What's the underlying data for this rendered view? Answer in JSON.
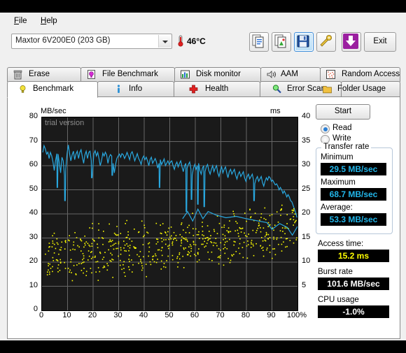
{
  "menu": {
    "file": "File",
    "help": "Help"
  },
  "device": {
    "selected": "Maxtor 6V200E0 (203 GB)",
    "temperature": "46°C",
    "thermometer_icon": "thermometer-icon"
  },
  "toolbar": {
    "buttons": [
      {
        "name": "copy-text-button",
        "icon": "copy-text-icon",
        "selected": false
      },
      {
        "name": "copy-image-button",
        "icon": "copy-image-icon",
        "selected": false
      },
      {
        "name": "save-button",
        "icon": "floppy-disk-icon",
        "selected": true
      },
      {
        "name": "tools-button",
        "icon": "tools-icon",
        "selected": false
      },
      {
        "name": "update-button",
        "icon": "download-arrow-icon",
        "selected": false
      }
    ],
    "exit_label": "Exit"
  },
  "tabs": {
    "row1": [
      {
        "label": "Erase",
        "icon": "trash-icon",
        "active": false
      },
      {
        "label": "File Benchmark",
        "icon": "file-bulb-icon",
        "active": false
      },
      {
        "label": "Disk monitor",
        "icon": "bar-chart-icon",
        "active": false
      },
      {
        "label": "AAM",
        "icon": "speaker-icon",
        "active": false
      },
      {
        "label": "Random Access",
        "icon": "dots-icon",
        "active": false
      }
    ],
    "row2": [
      {
        "label": "Benchmark",
        "icon": "bulb-icon",
        "active": true
      },
      {
        "label": "Info",
        "icon": "info-icon",
        "active": false
      },
      {
        "label": "Health",
        "icon": "red-cross-icon",
        "active": false
      },
      {
        "label": "Error Scan",
        "icon": "magnifier-icon",
        "active": false
      },
      {
        "label": "Folder Usage",
        "icon": "folder-icon",
        "active": false
      }
    ]
  },
  "panel": {
    "start_label": "Start",
    "read_label": "Read",
    "write_label": "Write",
    "read_selected": true,
    "transfer_rate_title": "Transfer rate",
    "minimum_label": "Minimum",
    "minimum_value": "29.5 MB/sec",
    "maximum_label": "Maximum",
    "maximum_value": "68.7 MB/sec",
    "average_label": "Average:",
    "average_value": "53.3 MB/sec",
    "access_time_label": "Access time:",
    "access_time_value": "15.2 ms",
    "burst_rate_label": "Burst rate",
    "burst_rate_value": "101.6 MB/sec",
    "cpu_usage_label": "CPU usage",
    "cpu_usage_value": "-1.0%"
  },
  "colors": {
    "transfer_line": "#29a8e0",
    "access_dots": "#ffff00",
    "plot_bg": "#1a1a1a",
    "grid": "#666666",
    "watermark": "#8c8c8c"
  },
  "chart_data": {
    "type": "line",
    "title": "",
    "watermark": "trial version",
    "xlabel": "",
    "ylabel": "MB/sec",
    "ylabel_right": "ms",
    "xlim": [
      0,
      100
    ],
    "ylim": [
      0,
      80
    ],
    "ylim_right": [
      0,
      40
    ],
    "grid": true,
    "xticks": [
      0,
      10,
      20,
      30,
      40,
      50,
      60,
      70,
      80,
      90,
      100
    ],
    "xticklabels": [
      "0",
      "10",
      "20",
      "30",
      "40",
      "50",
      "60",
      "70",
      "80",
      "90",
      "100%"
    ],
    "yticks": [
      0,
      10,
      20,
      30,
      40,
      50,
      60,
      70,
      80
    ],
    "yticklabels": [
      "0",
      "10",
      "20",
      "30",
      "40",
      "50",
      "60",
      "70",
      "80"
    ],
    "yticks_right": [
      5,
      10,
      15,
      20,
      25,
      30,
      35,
      40
    ],
    "yticklabels_right": [
      "5",
      "10",
      "15",
      "20",
      "25",
      "30",
      "35",
      "40"
    ],
    "series": [
      {
        "name": "Transfer rate",
        "type": "line",
        "color": "#29a8e0",
        "axis": "left",
        "units": "MB/sec",
        "x": [
          0.3,
          0.8,
          1.3,
          1.8,
          2.3,
          2.8,
          3.3,
          3.8,
          4.3,
          4.8,
          5.3,
          5.8,
          6.3,
          6.8,
          7.3,
          7.8,
          8.3,
          8.8,
          9.3,
          9.8,
          10.3,
          10.8,
          11.3,
          11.8,
          12.3,
          12.8,
          13.3,
          13.8,
          14.3,
          14.8,
          15.3,
          15.8,
          16.3,
          16.8,
          17.3,
          17.8,
          18.3,
          18.8,
          19.3,
          19.8,
          20.3,
          20.8,
          21.3,
          21.8,
          22.3,
          22.8,
          23.3,
          23.8,
          24.3,
          24.8,
          25.3,
          25.8,
          26.3,
          26.8,
          27.3,
          27.8,
          28.3,
          28.8,
          29.3,
          29.8,
          30.3,
          30.8,
          31.3,
          31.8,
          32.3,
          32.8,
          33.3,
          33.8,
          34.3,
          34.8,
          35.3,
          35.8,
          36.3,
          36.8,
          37.3,
          37.8,
          38.3,
          38.8,
          39.3,
          39.8,
          40.3,
          40.8,
          41.3,
          41.8,
          42.3,
          42.8,
          43.3,
          43.8,
          44.3,
          44.8,
          45.3,
          45.8,
          46.3,
          46.8,
          47.3,
          47.8,
          48.3,
          48.8,
          49.3,
          49.8,
          50.3,
          50.8,
          51.3,
          51.8,
          52.3,
          52.8,
          53.3,
          53.8,
          54.3,
          54.8,
          55.3,
          55.8,
          56.3,
          56.8,
          57.3,
          57.8,
          58.3,
          58.8,
          59.3,
          59.8,
          60.3,
          60.8,
          61.3,
          61.8,
          62.3,
          62.8,
          63.3,
          63.8,
          64.3,
          64.8,
          65.3,
          65.8,
          66.3,
          66.8,
          67.3,
          67.8,
          68.3,
          68.8,
          69.3,
          69.8,
          70.3,
          70.8,
          71.3,
          71.8,
          72.3,
          72.8,
          73.3,
          73.8,
          74.3,
          74.8,
          75.3,
          75.8,
          76.3,
          76.8,
          77.3,
          77.8,
          78.3,
          78.8,
          79.3,
          79.8,
          80.3,
          80.8,
          81.3,
          81.8,
          82.3,
          82.8,
          83.3,
          83.8,
          84.3,
          84.8,
          85.3,
          85.8,
          86.3,
          86.8,
          87.3,
          87.8,
          88.3,
          88.8,
          89.3,
          89.8,
          90.3,
          90.8,
          91.3,
          91.8,
          92.3,
          92.8,
          93.3,
          93.8,
          94.3,
          94.8,
          95.3,
          95.8,
          96.3,
          96.8,
          97.3,
          97.8,
          98.3,
          98.8,
          99.3,
          99.8
        ],
        "y": [
          65.5,
          68.3,
          67.0,
          64.8,
          65.6,
          63.0,
          65.5,
          64.0,
          61.5,
          58.0,
          62.0,
          65.0,
          64.8,
          61.0,
          57.0,
          63.5,
          62.0,
          56.0,
          58.5,
          65.0,
          68.6,
          65.0,
          62.0,
          64.5,
          66.0,
          62.5,
          64.8,
          66.0,
          63.0,
          65.5,
          66.6,
          63.5,
          61.0,
          64.5,
          66.0,
          63.0,
          65.5,
          66.0,
          62.0,
          58.0,
          65.0,
          66.2,
          64.0,
          65.5,
          63.0,
          60.0,
          62.0,
          65.2,
          64.0,
          65.6,
          64.5,
          61.0,
          63.5,
          64.6,
          64.0,
          61.0,
          57.0,
          60.5,
          63.0,
          64.0,
          64.8,
          63.5,
          65.0,
          64.5,
          63.0,
          64.0,
          65.5,
          64.0,
          62.5,
          65.0,
          65.8,
          64.0,
          62.0,
          63.5,
          65.0,
          63.0,
          62.0,
          60.5,
          63.0,
          64.0,
          62.5,
          63.5,
          62.0,
          60.0,
          62.5,
          63.5,
          61.0,
          62.0,
          63.0,
          61.5,
          59.0,
          61.0,
          62.5,
          60.5,
          61.5,
          62.8,
          60.0,
          61.0,
          62.0,
          60.5,
          61.5,
          62.0,
          60.0,
          58.5,
          60.5,
          61.5,
          59.5,
          61.0,
          62.0,
          59.5,
          57.5,
          60.0,
          61.0,
          59.0,
          60.5,
          61.5,
          58.5,
          56.0,
          59.0,
          60.5,
          58.5,
          60.0,
          61.0,
          58.0,
          56.5,
          59.0,
          60.0,
          57.5,
          59.5,
          60.5,
          58.0,
          56.5,
          58.5,
          60.0,
          57.5,
          59.0,
          60.0,
          57.0,
          55.5,
          58.0,
          59.5,
          57.0,
          58.5,
          59.5,
          57.0,
          55.0,
          57.5,
          58.5,
          56.5,
          57.5,
          58.5,
          56.0,
          54.5,
          56.5,
          57.5,
          55.5,
          56.5,
          57.5,
          55.0,
          53.5,
          55.5,
          56.5,
          54.5,
          55.5,
          56.5,
          54.0,
          52.5,
          54.5,
          55.5,
          53.5,
          54.5,
          55.5,
          53.0,
          51.5,
          53.5,
          55.0,
          54.0,
          55.5,
          55.0,
          53.5,
          54.0,
          53.0,
          52.0,
          52.5,
          51.5,
          50.0,
          51.0,
          50.0,
          48.5,
          49.5,
          48.5,
          47.0,
          48.0,
          47.0,
          45.5,
          45.0,
          43.5,
          42.0,
          40.5,
          38.5
        ],
        "deep_dips": [
          {
            "x": 6.0,
            "y": 51.0
          },
          {
            "x": 9.0,
            "y": 45.5
          },
          {
            "x": 19.5,
            "y": 55.0
          },
          {
            "x": 27.5,
            "y": 56.0
          },
          {
            "x": 46.0,
            "y": 51.0
          },
          {
            "x": 56.5,
            "y": 41.0
          },
          {
            "x": 58.5,
            "y": 46.0
          },
          {
            "x": 61.0,
            "y": 44.0
          },
          {
            "x": 63.5,
            "y": 43.0
          },
          {
            "x": 83.0,
            "y": 45.5
          }
        ]
      },
      {
        "name": "Access time",
        "type": "scatter",
        "color": "#ffff00",
        "axis": "right",
        "units": "ms",
        "x": [
          1.5,
          2.4,
          3.1,
          3.8,
          4.6,
          5.2,
          6.1,
          6.8,
          7.5,
          8.3,
          9.0,
          9.8,
          10.5,
          11.2,
          12.0,
          12.7,
          13.5,
          14.2,
          15.0,
          15.7,
          16.4,
          17.1,
          17.9,
          18.6,
          19.3,
          20.1,
          20.8,
          21.5,
          22.3,
          23.0,
          23.7,
          24.5,
          25.2,
          25.9,
          26.7,
          27.4,
          28.1,
          28.9,
          29.6,
          30.3,
          31.1,
          31.8,
          32.5,
          33.3,
          34.0,
          34.7,
          35.5,
          36.2,
          36.9,
          37.7,
          38.4,
          39.1,
          39.9,
          40.6,
          41.3,
          42.1,
          42.8,
          43.5,
          44.3,
          45.0,
          45.7,
          46.5,
          47.2,
          47.9,
          48.7,
          49.4,
          50.1,
          50.9,
          51.6,
          52.3,
          53.1,
          53.8,
          54.5,
          55.3,
          56.0,
          56.7,
          57.5,
          58.2,
          58.9,
          59.7,
          60.4,
          61.1,
          61.9,
          62.6,
          63.3,
          64.1,
          64.8,
          65.5,
          66.3,
          67.0,
          67.7,
          68.5,
          69.2,
          69.9,
          70.7,
          71.4,
          72.1,
          72.9,
          73.6,
          74.3,
          75.1,
          75.8,
          76.5,
          77.3,
          78.0,
          78.7,
          79.5,
          80.2,
          80.9,
          81.7,
          82.4,
          83.1,
          83.9,
          84.6,
          85.3,
          86.1,
          86.8,
          87.5,
          88.3,
          89.0,
          89.7,
          90.5,
          91.2,
          91.9,
          92.7,
          93.4,
          94.1,
          94.9,
          95.6,
          96.3,
          97.1,
          97.8,
          98.5,
          99.3
        ],
        "y": [
          9.5,
          11.0,
          10.2,
          12.5,
          9.8,
          13.0,
          11.5,
          10.5,
          12.0,
          14.5,
          10.0,
          13.5,
          11.0,
          9.5,
          12.5,
          15.0,
          10.5,
          11.5,
          13.0,
          9.8,
          12.0,
          14.0,
          10.5,
          13.5,
          11.0,
          16.5,
          12.5,
          10.0,
          14.5,
          11.5,
          13.0,
          9.5,
          12.0,
          15.5,
          11.0,
          13.5,
          10.5,
          12.5,
          14.0,
          11.5,
          13.0,
          10.0,
          15.0,
          12.0,
          13.5,
          11.0,
          14.5,
          12.5,
          10.5,
          13.0,
          11.5,
          15.5,
          12.0,
          14.0,
          10.5,
          13.5,
          12.5,
          11.0,
          14.5,
          13.0,
          12.0,
          15.0,
          13.5,
          11.5,
          14.0,
          12.5,
          16.0,
          13.0,
          11.5,
          14.5,
          12.0,
          15.5,
          13.5,
          12.5,
          14.0,
          11.0,
          15.0,
          13.0,
          16.5,
          12.5,
          14.5,
          13.0,
          15.5,
          12.0,
          14.0,
          16.0,
          13.5,
          12.5,
          15.0,
          14.0,
          17.0,
          13.0,
          15.5,
          14.5,
          12.5,
          16.0,
          14.0,
          15.0,
          13.5,
          17.5,
          14.5,
          16.0,
          13.0,
          15.5,
          14.0,
          17.0,
          15.0,
          16.5,
          14.0,
          18.0,
          15.5,
          14.5,
          16.5,
          15.0,
          17.5,
          14.0,
          16.0,
          18.5,
          15.5,
          17.0,
          14.5,
          16.5,
          18.0,
          15.0,
          17.5,
          16.0,
          19.0,
          15.5,
          17.0,
          18.5,
          16.5,
          19.5,
          17.5,
          18.0
        ]
      },
      {
        "name": "Access time average line",
        "type": "line",
        "color": "#29a8e0",
        "axis": "right",
        "note": "trailing segment near 86-100% around 17-20 ms"
      }
    ]
  }
}
